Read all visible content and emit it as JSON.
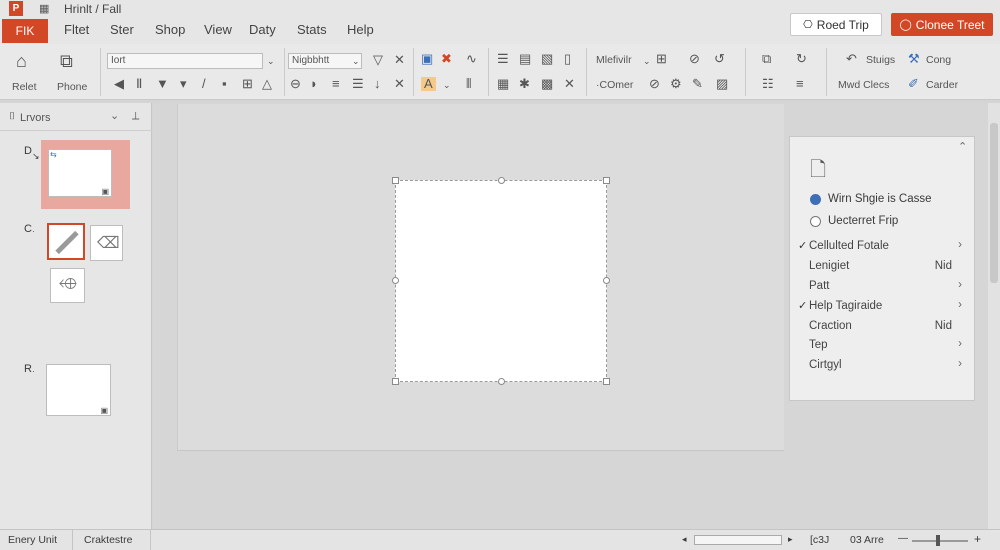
{
  "app": {
    "title": "Hrinlt / Fall",
    "logo_letter": "P"
  },
  "tabs": {
    "file": "FIK",
    "items": [
      "Fltet",
      "Ster",
      "Shop",
      "View",
      "Daty",
      "Stats",
      "Help"
    ]
  },
  "top_buttons": {
    "reed_trip": "Roed Trip",
    "close_trip": "Clonee Treet"
  },
  "ribbon": {
    "relet": "Relet",
    "phone": "Phone",
    "font_box": "Iort",
    "style_box": "Nigbbhtt",
    "medium": "Mlefivilr",
    "comer": "·COmer",
    "stuige": "Stuigs",
    "cong": "Cong",
    "mend_close": "Mwd Clecs",
    "carder": "Carder"
  },
  "left_pane": {
    "title": "Lrvors",
    "labels": [
      "D",
      "C",
      "R"
    ]
  },
  "task_pane": {
    "radio1": "Wirn Shgie is Casse",
    "radio2": "Uecterret Frip",
    "rows": [
      {
        "label": "Cellulted Fotale",
        "check": "✓",
        "value": "",
        "arrow": "›"
      },
      {
        "label": "Lenigiet",
        "check": "",
        "value": "Nid",
        "arrow": ""
      },
      {
        "label": "Patt",
        "check": "",
        "value": "",
        "arrow": "›"
      },
      {
        "label": "Help Tagiraide",
        "check": "✓",
        "value": "",
        "arrow": "›"
      },
      {
        "label": "Craction",
        "check": "",
        "value": "Nid",
        "arrow": ""
      },
      {
        "label": "Tep",
        "check": "",
        "value": "",
        "arrow": "›"
      },
      {
        "label": "Cirtgyl",
        "check": "",
        "value": "",
        "arrow": "›"
      }
    ]
  },
  "status": {
    "left1": "Enery Unit",
    "left2": "Craktestre",
    "page": "[c3J",
    "zoom": "03 Arre"
  },
  "colors": {
    "accent": "#d24726",
    "background": "#d4d4d4"
  }
}
